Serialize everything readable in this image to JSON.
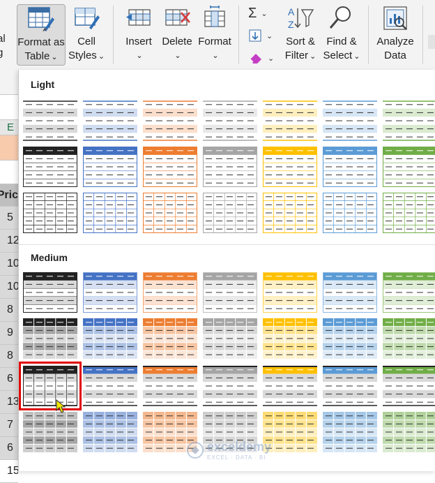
{
  "ribbon": {
    "left_cut_top": "al",
    "left_cut_bottom": "g",
    "format_as_table": {
      "line1": "Format as",
      "line2": "Table",
      "chevron": "⌄"
    },
    "cell_styles": {
      "line1": "Cell",
      "line2": "Styles",
      "chevron": "⌄"
    },
    "insert": {
      "label": "Insert",
      "chevron": "⌄"
    },
    "delete": {
      "label": "Delete",
      "chevron": "⌄"
    },
    "format": {
      "label": "Format",
      "chevron": "⌄"
    },
    "autosum": {
      "glyph": "Σ",
      "chevron": "⌄"
    },
    "fill": {
      "chevron": "⌄"
    },
    "clear": {
      "chevron": "⌄"
    },
    "sort_filter": {
      "line1": "Sort &",
      "line2": "Filter",
      "chevron": "⌄"
    },
    "find_select": {
      "line1": "Find &",
      "line2": "Select",
      "chevron": "⌄"
    },
    "analyze": {
      "line1": "Analyze",
      "line2": "Data"
    }
  },
  "sheet": {
    "column_letter": "E",
    "header_cell": "Pric",
    "cells": [
      "5",
      "12",
      "10",
      "10",
      "8",
      "9",
      "8",
      "6",
      "13",
      "7",
      "6",
      "15"
    ]
  },
  "gallery": {
    "light_title": "Light",
    "medium_title": "Medium"
  },
  "watermark": {
    "name": "exceldemy",
    "tagline": "EXCEL · DATA · BI"
  },
  "colors": {
    "black": "#222222",
    "blue": "#4472c4",
    "orange": "#ed7d31",
    "gray": "#a5a5a5",
    "gold": "#ffc000",
    "lightblue": "#5b9bd5",
    "green": "#70ad47",
    "selection": "#e00000"
  }
}
